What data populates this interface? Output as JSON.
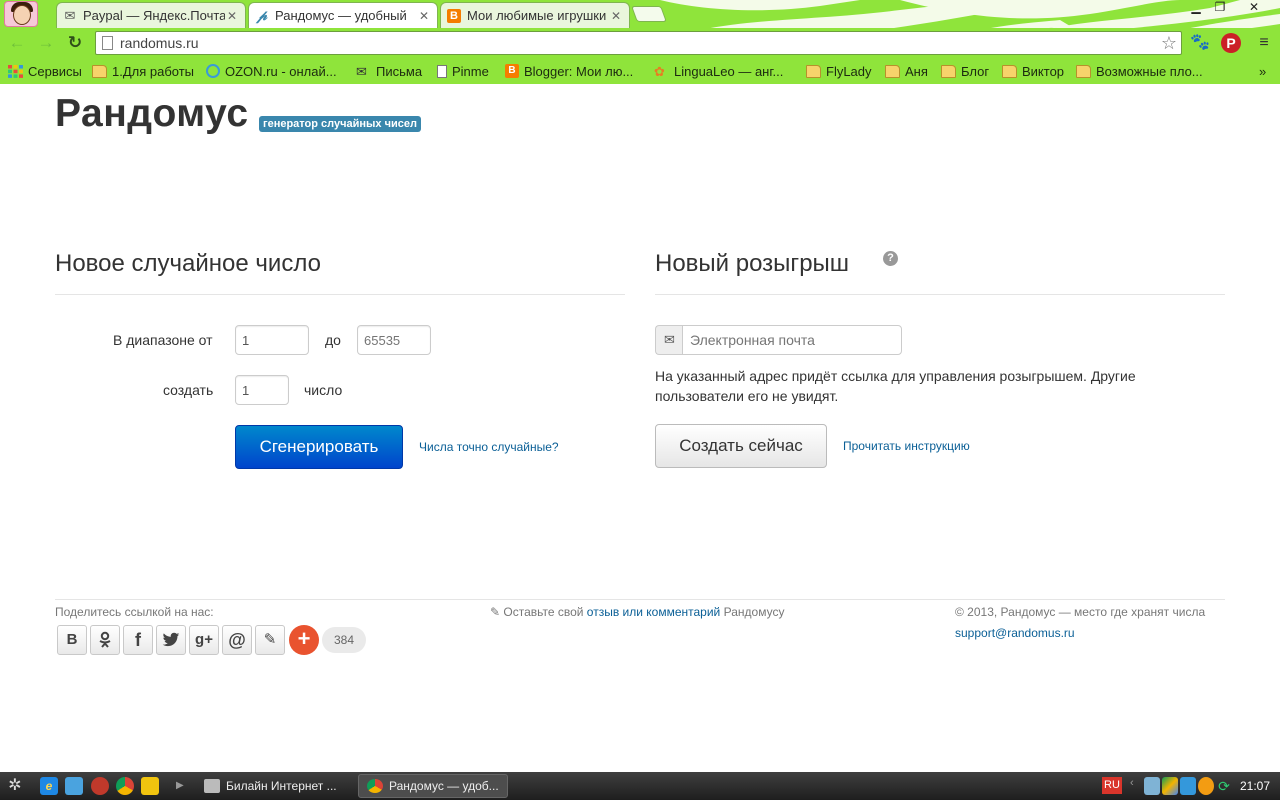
{
  "browser": {
    "tabs": [
      {
        "title": "Paypal — Яндекс.Почта",
        "favicon": "mail-icon"
      },
      {
        "title": "Рандомус — удобный",
        "favicon": "pinterest-p-icon"
      },
      {
        "title": "Мои любимые игрушки",
        "favicon": "blogger-icon"
      }
    ],
    "url": "randomus.ru",
    "bookmarks": [
      {
        "label": "Сервисы",
        "icon": "apps-grid-icon"
      },
      {
        "label": "1.Для работы",
        "icon": "folder-icon"
      },
      {
        "label": "OZON.ru - онлай...",
        "icon": "ozon-icon"
      },
      {
        "label": "Письма",
        "icon": "mail-icon"
      },
      {
        "label": "Pinme",
        "icon": "page-icon"
      },
      {
        "label": "Blogger: Мои лю...",
        "icon": "blogger-icon"
      },
      {
        "label": "LinguaLeo — анг...",
        "icon": "lingualeo-icon"
      },
      {
        "label": "FlyLady",
        "icon": "folder-icon"
      },
      {
        "label": "Аня",
        "icon": "folder-icon"
      },
      {
        "label": "Блог",
        "icon": "folder-icon"
      },
      {
        "label": "Виктор",
        "icon": "folder-icon"
      },
      {
        "label": "Возможные пло...",
        "icon": "folder-icon"
      }
    ],
    "bookmarks_more": "»"
  },
  "header": {
    "brand": "Рандомус",
    "tagline": "генератор случайных чисел"
  },
  "random_number": {
    "title": "Новое случайное число",
    "range_from_label": "В диапазоне от",
    "range_from_value": "1",
    "range_to_label": "до",
    "range_to_placeholder": "65535",
    "count_label": "создать",
    "count_value": "1",
    "count_unit": "число",
    "generate_button": "Сгенерировать",
    "random_link": "Числа точно случайные?"
  },
  "raffle": {
    "title": "Новый розыгрыш",
    "help_symbol": "?",
    "email_placeholder": "Электронная почта",
    "note": "На указанный адрес придёт ссылка для управления розыгрышем. Другие пользователи его не увидят.",
    "create_button": "Создать сейчас",
    "instructions_link": "Прочитать инструкцию"
  },
  "footer": {
    "share_label": "Поделитесь ссылкой на нас:",
    "share_buttons": [
      "В",
      "ok",
      "f",
      "twitter",
      "g+",
      "@",
      "pencil"
    ],
    "share_count": "384",
    "feedback_prefix": "Оставьте свой",
    "feedback_link": "отзыв или комментарий",
    "feedback_suffix": "Рандомусу",
    "copyright": "© 2013, Рандомус — место где хранят числа",
    "support_email": "support@randomus.ru"
  },
  "taskbar": {
    "tasks": [
      {
        "label": "Билайн Интернет ...",
        "active": false
      },
      {
        "label": "Рандомус — удоб...",
        "active": true
      }
    ],
    "language": "RU",
    "clock": "21:07"
  },
  "colors": {
    "chrome_green": "#8fe43b",
    "primary_blue": "#0055cc",
    "label_blue": "#3a87ad",
    "link_blue": "#0a5f96"
  }
}
